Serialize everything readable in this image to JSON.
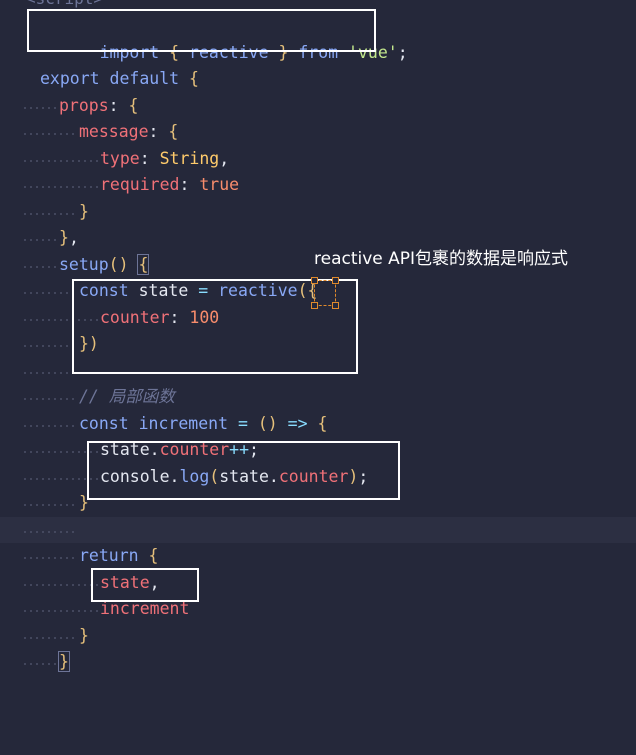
{
  "top_fragment": "<script>",
  "lines": [
    {
      "key": "l1",
      "text": "import { reactive } from 'vue';"
    },
    {
      "key": "l2",
      "text": "export default {"
    },
    {
      "key": "l3",
      "text": "props: {"
    },
    {
      "key": "l4",
      "text": "message: {"
    },
    {
      "key": "l5",
      "text": "type: String,"
    },
    {
      "key": "l6",
      "text": "required: true"
    },
    {
      "key": "l7",
      "text": "}"
    },
    {
      "key": "l8",
      "text": "},"
    },
    {
      "key": "l9",
      "text": "setup() {"
    },
    {
      "key": "l10",
      "text": "const state = reactive({"
    },
    {
      "key": "l11",
      "text": "counter: 100"
    },
    {
      "key": "l12",
      "text": "})"
    },
    {
      "key": "l13",
      "text": "// 局部函数"
    },
    {
      "key": "l14",
      "text": "const increment = () => {"
    },
    {
      "key": "l15",
      "text": "state.counter++;"
    },
    {
      "key": "l16",
      "text": "console.log(state.counter);"
    },
    {
      "key": "l17",
      "text": "}"
    },
    {
      "key": "l18",
      "text": "return {"
    },
    {
      "key": "l19",
      "text": "state,"
    },
    {
      "key": "l20",
      "text": "increment"
    },
    {
      "key": "l21",
      "text": "}"
    },
    {
      "key": "l22",
      "text": "}"
    }
  ],
  "annotation": "reactive API包裹的数据是响应式",
  "colors": {
    "background": "#25283a",
    "keyword": "#89a8f5",
    "string": "#c3e88d",
    "number": "#f78c6c",
    "highlight_box": "#ffffff",
    "cursor_box": "#e08a2c"
  }
}
